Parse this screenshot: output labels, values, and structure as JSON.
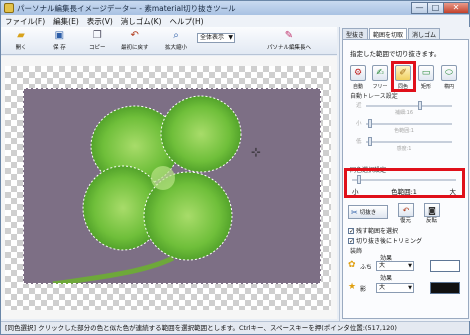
{
  "window": {
    "title": "パーソナル編集長イメージデーター - 素material切り抜きツール",
    "controls": {
      "minimize": "—",
      "maximize": "□",
      "close": "✕"
    }
  },
  "menubar": [
    "ファイル(F)",
    "編集(E)",
    "表示(V)",
    "消しゴム(K)",
    "ヘルプ(H)"
  ],
  "toolbar": {
    "buttons": [
      {
        "label": "開く",
        "icon": "folder-icon"
      },
      {
        "label": "保 存",
        "icon": "save-icon"
      },
      {
        "label": "コピー",
        "icon": "copy-icon"
      },
      {
        "label": "最初に戻す",
        "icon": "undo-icon"
      },
      {
        "label": "拡大縮小",
        "icon": "zoom-icon"
      },
      {
        "label": "パソナル編集長へ",
        "icon": "send-icon"
      }
    ],
    "view_select": "全体表示"
  },
  "panel": {
    "tabs": [
      "型抜き",
      "範囲を切取",
      "消しゴム"
    ],
    "active_tab": 1,
    "description": "指定した範囲で切り抜きます。",
    "modes": [
      {
        "label": "自動",
        "icon": "auto-icon"
      },
      {
        "label": "フリー",
        "icon": "free-icon"
      },
      {
        "label": "同色",
        "icon": "same-color-icon"
      },
      {
        "label": "矩形",
        "icon": "rect-icon"
      },
      {
        "label": "楕円",
        "icon": "ellipse-icon"
      }
    ],
    "auto_trace": {
      "title": "自動トレース設定",
      "rows": [
        {
          "label": "近",
          "mid": "補細:16"
        },
        {
          "label": "小",
          "mid": "色範囲:1"
        },
        {
          "label": "低",
          "mid": "感度:1"
        }
      ]
    },
    "color_range": {
      "title": "同色選択設定",
      "min": "小",
      "label": "色範囲:1",
      "max": "大",
      "level": 0.05
    },
    "actions": {
      "cut": "切抜き",
      "restore": "復元",
      "invert": "反転"
    },
    "checkboxes": [
      {
        "label": "残す範囲を選択",
        "checked": true
      },
      {
        "label": "切り抜き後にトリミング",
        "checked": true
      }
    ],
    "decoration": {
      "title": "装飾",
      "rows": [
        {
          "label": "ふち",
          "effect_label": "効果",
          "value": "大",
          "color": "#ffffff",
          "icon": "border-icon"
        },
        {
          "label": "影",
          "effect_label": "効果",
          "value": "大",
          "color": "#111111",
          "icon": "shadow-icon"
        }
      ]
    }
  },
  "statusbar": "[同色選択] クリックした部分の色と似た色が連続する範囲を選択範囲とします。Ctrlキー、スペースキーを押(ポインタ位置:(517,120)"
}
